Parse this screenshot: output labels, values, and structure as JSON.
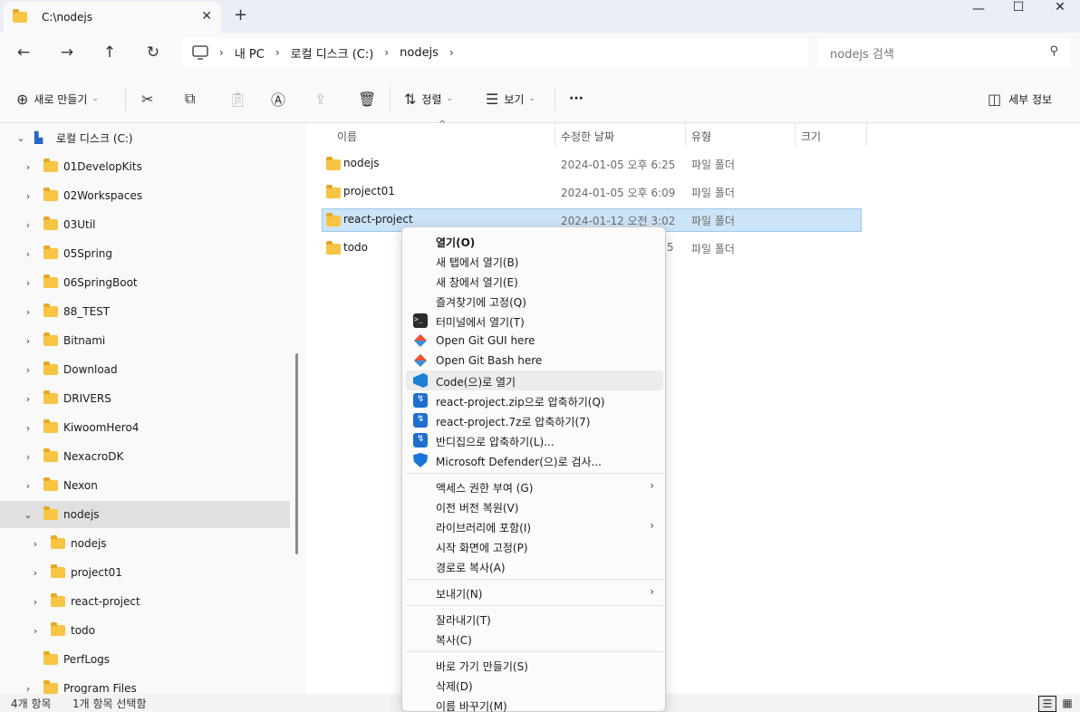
{
  "window": {
    "tab_title": "C:\\nodejs",
    "new_tab": "+",
    "controls": {
      "minimize": "—",
      "maximize": "☐",
      "close": "✕"
    }
  },
  "nav": {
    "back": "←",
    "forward": "→",
    "up": "↑",
    "refresh": "↻",
    "breadcrumbs": [
      "내 PC",
      "로컬 디스크 (C:)",
      "nodejs"
    ],
    "search_placeholder": "nodejs 검색"
  },
  "toolbar": {
    "new_label": "새로 만들기",
    "sort_label": "정렬",
    "view_label": "보기",
    "more": "···",
    "details_label": "세부 정보"
  },
  "sidebar": {
    "drive_label": "로컬 디스크 (C:)",
    "items": [
      {
        "label": "01DevelopKits"
      },
      {
        "label": "02Workspaces"
      },
      {
        "label": "03Util"
      },
      {
        "label": "05Spring"
      },
      {
        "label": "06SpringBoot"
      },
      {
        "label": "88_TEST"
      },
      {
        "label": "Bitnami"
      },
      {
        "label": "Download"
      },
      {
        "label": "DRIVERS"
      },
      {
        "label": "KiwoomHero4"
      },
      {
        "label": "NexacroDK"
      },
      {
        "label": "Nexon"
      },
      {
        "label": "nodejs"
      },
      {
        "label": "nodejs"
      },
      {
        "label": "project01"
      },
      {
        "label": "react-project"
      },
      {
        "label": "todo"
      },
      {
        "label": "PerfLogs"
      },
      {
        "label": "Program Files"
      }
    ]
  },
  "columns": {
    "name": "이름",
    "date": "수정한 날짜",
    "type": "유형",
    "size": "크기"
  },
  "files": [
    {
      "name": "nodejs",
      "date": "2024-01-05 오후 6:25",
      "type": "파일 폴더"
    },
    {
      "name": "project01",
      "date": "2024-01-05 오후 6:09",
      "type": "파일 폴더"
    },
    {
      "name": "react-project",
      "date": "2024-01-12 오전 3:02",
      "type": "파일 폴더"
    },
    {
      "name": "todo",
      "date": "5",
      "type": "파일 폴더"
    }
  ],
  "context_menu": {
    "items": [
      "열기(O)",
      "새 탭에서 열기(B)",
      "새 창에서 열기(E)",
      "즐겨찾기에 고정(Q)",
      "터미널에서 열기(T)",
      "Open Git GUI here",
      "Open Git Bash here",
      "Code(으)로 열기",
      "react-project.zip으로 압축하기(Q)",
      "react-project.7z로 압축하기(7)",
      "반디집으로 압축하기(L)...",
      "Microsoft Defender(으)로 검사...",
      "액세스 권한 부여 (G)",
      "이전 버전 복원(V)",
      "라이브러리에 포함(I)",
      "시작 화면에 고정(P)",
      "경로로 복사(A)",
      "보내기(N)",
      "잘라내기(T)",
      "복사(C)",
      "바로 가기 만들기(S)",
      "삭제(D)",
      "이름 바꾸기(M)"
    ]
  },
  "status": {
    "count": "4개 항목",
    "selected": "1개 항목 선택함"
  }
}
